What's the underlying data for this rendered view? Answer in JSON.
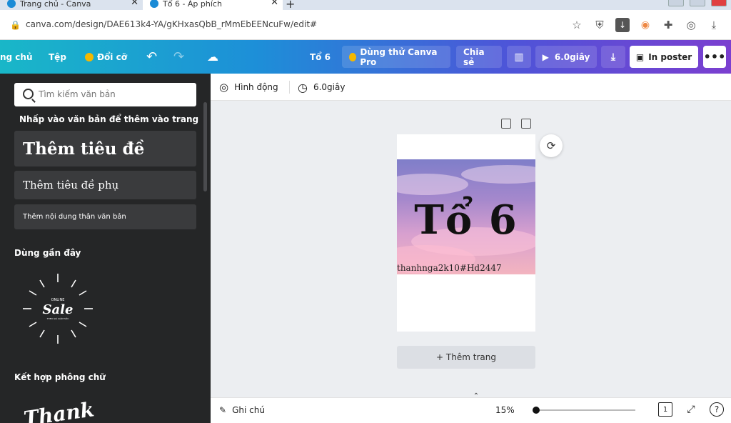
{
  "browser": {
    "tabs": [
      {
        "title": "Trang chủ - Canva"
      },
      {
        "title": "Tổ 6 - Áp phích"
      }
    ],
    "new_tab": "+",
    "url": "canva.com/design/DAE613k4-YA/gKHxasQbB_rMmEbEENcuFw/edit#"
  },
  "topbar": {
    "home": "ng chủ",
    "file": "Tệp",
    "resize": "Đổi cỡ",
    "title": "Tổ 6",
    "try_pro": "Dùng thử Canva Pro",
    "share": "Chia sẻ",
    "play_duration": "6.0giây",
    "print_poster": "In poster",
    "more": "•••"
  },
  "sidebar": {
    "search_placeholder": "Tìm kiếm văn bản",
    "hint": "Nhấp vào văn bản để thêm vào trang",
    "add_heading": "Thêm tiêu đề",
    "add_subheading": "Thêm tiêu đề phụ",
    "add_body": "Thêm nội dung thân văn bản",
    "recent_heading": "Dùng gần đây",
    "recent_item": {
      "top": "ONLINE",
      "main": "Sale",
      "bottom": "THEO GIÁ GIẢM SỐC"
    },
    "font_combo_heading": "Kết hợp phông chữ",
    "font_combo_preview": "Thank"
  },
  "subbar": {
    "animate": "Hình động",
    "duration": "6.0giây"
  },
  "design": {
    "title": "Tổ 6",
    "handle": "thanhnga2k10#Hd2447"
  },
  "canvas": {
    "add_page": "+ Thêm trang"
  },
  "bottombar": {
    "notes": "Ghi chú",
    "zoom": "15%",
    "zoom_level": 0.0,
    "page_count": "1",
    "help": "?"
  }
}
